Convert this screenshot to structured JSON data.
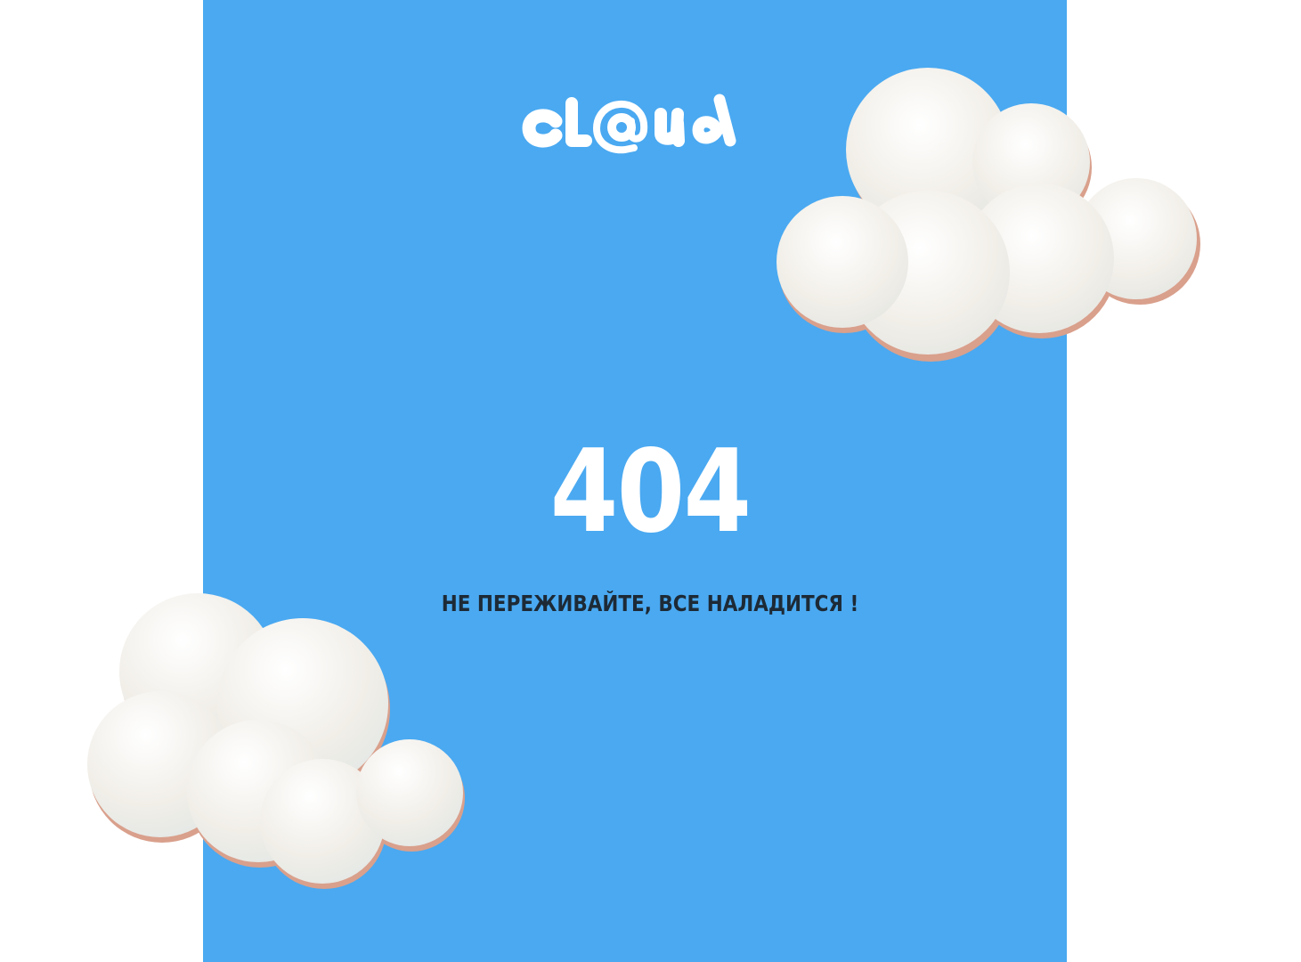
{
  "brand": {
    "logo_text": "cl@ud"
  },
  "error": {
    "code": "404",
    "message": "НЕ ПЕРЕЖИВАЙТЕ, ВСЕ НАЛАДИТСЯ !"
  },
  "colors": {
    "sky": "#4aa9f1",
    "text_white": "#ffffff",
    "text_dark": "#1d2a36",
    "cloud_light": "#f7f5f1",
    "cloud_shadow": "#d9a08c"
  }
}
